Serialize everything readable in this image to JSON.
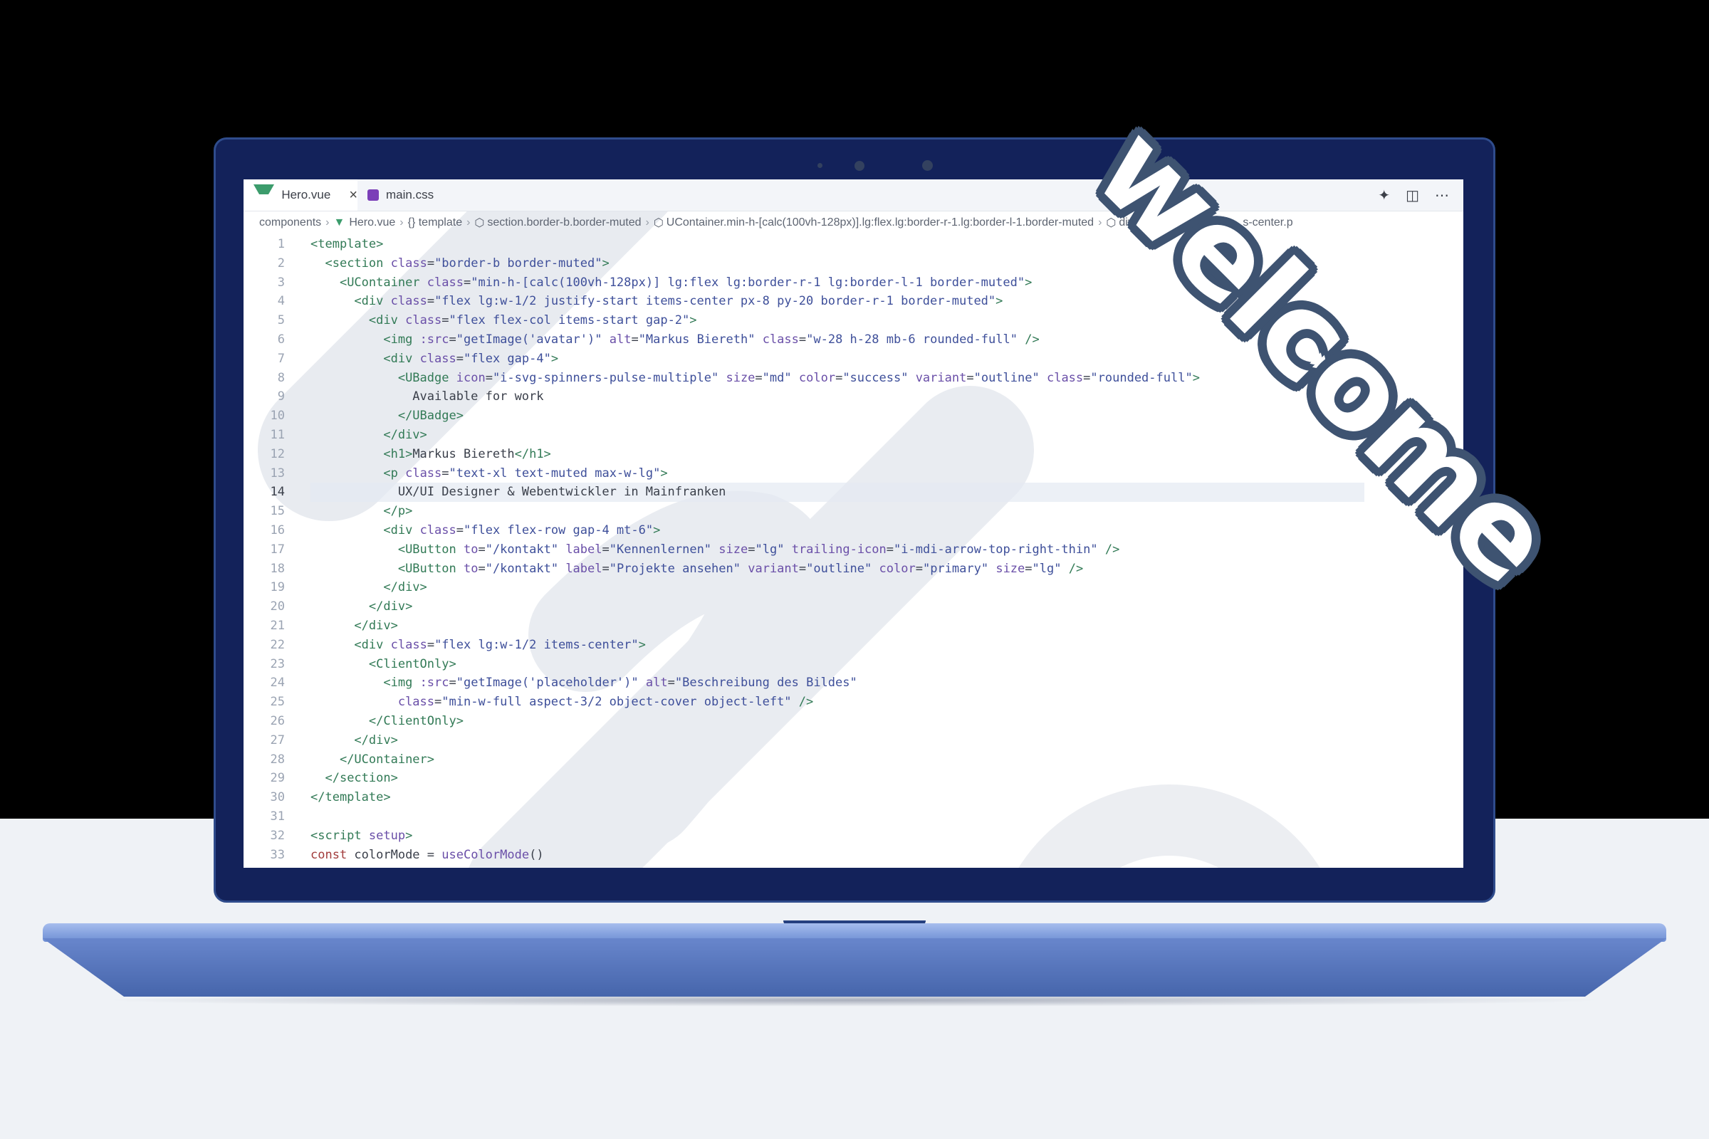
{
  "editor": {
    "tabs": [
      {
        "label": "Hero.vue",
        "icon": "vue-file-icon",
        "active": true
      },
      {
        "label": "main.css",
        "icon": "css-file-icon",
        "active": false
      }
    ],
    "toolbar_icons": [
      "sparkle-icon",
      "split-editor-icon",
      "more-icon"
    ],
    "breadcrumbs": [
      "components",
      "Hero.vue",
      "{} template",
      "section.border-b.border-muted",
      "UContainer.min-h-[calc(100vh-128px)].lg:flex.lg:border-r-1.lg:border-l-1.border-muted",
      "div.flex.lg:w...",
      "s-center.p"
    ],
    "current_line": 14,
    "lines": [
      {
        "n": "1",
        "tokens": [
          [
            "t",
            "<template>"
          ]
        ]
      },
      {
        "n": "2",
        "tokens": [
          [
            "p",
            "  "
          ],
          [
            "t",
            "<section"
          ],
          [
            "p",
            " "
          ],
          [
            "a",
            "class"
          ],
          [
            "p",
            "="
          ],
          [
            "s",
            "\"border-b border-muted\""
          ],
          [
            "t",
            ">"
          ]
        ]
      },
      {
        "n": "3",
        "tokens": [
          [
            "p",
            "    "
          ],
          [
            "t",
            "<UContainer"
          ],
          [
            "p",
            " "
          ],
          [
            "a",
            "class"
          ],
          [
            "p",
            "="
          ],
          [
            "s",
            "\"min-h-[calc(100vh-128px)] lg:flex lg:border-r-1 lg:border-l-1 border-muted\""
          ],
          [
            "t",
            ">"
          ]
        ]
      },
      {
        "n": "4",
        "tokens": [
          [
            "p",
            "      "
          ],
          [
            "t",
            "<div"
          ],
          [
            "p",
            " "
          ],
          [
            "a",
            "class"
          ],
          [
            "p",
            "="
          ],
          [
            "s",
            "\"flex lg:w-1/2 justify-start items-center px-8 py-20 border-r-1 border-muted\""
          ],
          [
            "t",
            ">"
          ]
        ]
      },
      {
        "n": "5",
        "tokens": [
          [
            "p",
            "        "
          ],
          [
            "t",
            "<div"
          ],
          [
            "p",
            " "
          ],
          [
            "a",
            "class"
          ],
          [
            "p",
            "="
          ],
          [
            "s",
            "\"flex flex-col items-start gap-2\""
          ],
          [
            "t",
            ">"
          ]
        ]
      },
      {
        "n": "6",
        "tokens": [
          [
            "p",
            "          "
          ],
          [
            "t",
            "<img"
          ],
          [
            "p",
            " "
          ],
          [
            "a",
            ":src"
          ],
          [
            "p",
            "="
          ],
          [
            "s",
            "\"getImage('avatar')\""
          ],
          [
            "p",
            " "
          ],
          [
            "a",
            "alt"
          ],
          [
            "p",
            "="
          ],
          [
            "s",
            "\"Markus Biereth\""
          ],
          [
            "p",
            " "
          ],
          [
            "a",
            "class"
          ],
          [
            "p",
            "="
          ],
          [
            "s",
            "\"w-28 h-28 mb-6 rounded-full\""
          ],
          [
            "p",
            " "
          ],
          [
            "t",
            "/>"
          ]
        ]
      },
      {
        "n": "7",
        "tokens": [
          [
            "p",
            "          "
          ],
          [
            "t",
            "<div"
          ],
          [
            "p",
            " "
          ],
          [
            "a",
            "class"
          ],
          [
            "p",
            "="
          ],
          [
            "s",
            "\"flex gap-4\""
          ],
          [
            "t",
            ">"
          ]
        ]
      },
      {
        "n": "8",
        "tokens": [
          [
            "p",
            "            "
          ],
          [
            "t",
            "<UBadge"
          ],
          [
            "p",
            " "
          ],
          [
            "a",
            "icon"
          ],
          [
            "p",
            "="
          ],
          [
            "s",
            "\"i-svg-spinners-pulse-multiple\""
          ],
          [
            "p",
            " "
          ],
          [
            "a",
            "size"
          ],
          [
            "p",
            "="
          ],
          [
            "s",
            "\"md\""
          ],
          [
            "p",
            " "
          ],
          [
            "a",
            "color"
          ],
          [
            "p",
            "="
          ],
          [
            "s",
            "\"success\""
          ],
          [
            "p",
            " "
          ],
          [
            "a",
            "variant"
          ],
          [
            "p",
            "="
          ],
          [
            "s",
            "\"outline\""
          ],
          [
            "p",
            " "
          ],
          [
            "a",
            "class"
          ],
          [
            "p",
            "="
          ],
          [
            "s",
            "\"rounded-full\""
          ],
          [
            "t",
            ">"
          ]
        ]
      },
      {
        "n": "9",
        "tokens": [
          [
            "p",
            "              Available for work"
          ]
        ]
      },
      {
        "n": "10",
        "tokens": [
          [
            "p",
            "            "
          ],
          [
            "t",
            "</UBadge>"
          ]
        ]
      },
      {
        "n": "11",
        "tokens": [
          [
            "p",
            "          "
          ],
          [
            "t",
            "</div>"
          ]
        ]
      },
      {
        "n": "12",
        "tokens": [
          [
            "p",
            "          "
          ],
          [
            "t",
            "<h1>"
          ],
          [
            "p",
            "Markus Biereth"
          ],
          [
            "t",
            "</h1>"
          ]
        ]
      },
      {
        "n": "13",
        "tokens": [
          [
            "p",
            "          "
          ],
          [
            "t",
            "<p"
          ],
          [
            "p",
            " "
          ],
          [
            "a",
            "class"
          ],
          [
            "p",
            "="
          ],
          [
            "s",
            "\"text-xl text-muted max-w-lg\""
          ],
          [
            "t",
            ">"
          ]
        ]
      },
      {
        "n": "14",
        "tokens": [
          [
            "p",
            "            UX/UI Designer & Webentwickler in Mainfranken"
          ]
        ]
      },
      {
        "n": "15",
        "tokens": [
          [
            "p",
            "          "
          ],
          [
            "t",
            "</p>"
          ]
        ]
      },
      {
        "n": "16",
        "tokens": [
          [
            "p",
            "          "
          ],
          [
            "t",
            "<div"
          ],
          [
            "p",
            " "
          ],
          [
            "a",
            "class"
          ],
          [
            "p",
            "="
          ],
          [
            "s",
            "\"flex flex-row gap-4 mt-6\""
          ],
          [
            "t",
            ">"
          ]
        ]
      },
      {
        "n": "17",
        "tokens": [
          [
            "p",
            "            "
          ],
          [
            "t",
            "<UButton"
          ],
          [
            "p",
            " "
          ],
          [
            "a",
            "to"
          ],
          [
            "p",
            "="
          ],
          [
            "s",
            "\"/kontakt\""
          ],
          [
            "p",
            " "
          ],
          [
            "a",
            "label"
          ],
          [
            "p",
            "="
          ],
          [
            "s",
            "\"Kennenlernen\""
          ],
          [
            "p",
            " "
          ],
          [
            "a",
            "size"
          ],
          [
            "p",
            "="
          ],
          [
            "s",
            "\"lg\""
          ],
          [
            "p",
            " "
          ],
          [
            "a",
            "trailing-icon"
          ],
          [
            "p",
            "="
          ],
          [
            "s",
            "\"i-mdi-arrow-top-right-thin\""
          ],
          [
            "p",
            " "
          ],
          [
            "t",
            "/>"
          ]
        ]
      },
      {
        "n": "18",
        "tokens": [
          [
            "p",
            "            "
          ],
          [
            "t",
            "<UButton"
          ],
          [
            "p",
            " "
          ],
          [
            "a",
            "to"
          ],
          [
            "p",
            "="
          ],
          [
            "s",
            "\"/kontakt\""
          ],
          [
            "p",
            " "
          ],
          [
            "a",
            "label"
          ],
          [
            "p",
            "="
          ],
          [
            "s",
            "\"Projekte ansehen\""
          ],
          [
            "p",
            " "
          ],
          [
            "a",
            "variant"
          ],
          [
            "p",
            "="
          ],
          [
            "s",
            "\"outline\""
          ],
          [
            "p",
            " "
          ],
          [
            "a",
            "color"
          ],
          [
            "p",
            "="
          ],
          [
            "s",
            "\"primary\""
          ],
          [
            "p",
            " "
          ],
          [
            "a",
            "size"
          ],
          [
            "p",
            "="
          ],
          [
            "s",
            "\"lg\""
          ],
          [
            "p",
            " "
          ],
          [
            "t",
            "/>"
          ]
        ]
      },
      {
        "n": "19",
        "tokens": [
          [
            "p",
            "          "
          ],
          [
            "t",
            "</div>"
          ]
        ]
      },
      {
        "n": "20",
        "tokens": [
          [
            "p",
            "        "
          ],
          [
            "t",
            "</div>"
          ]
        ]
      },
      {
        "n": "21",
        "tokens": [
          [
            "p",
            "      "
          ],
          [
            "t",
            "</div>"
          ]
        ]
      },
      {
        "n": "22",
        "tokens": [
          [
            "p",
            "      "
          ],
          [
            "t",
            "<div"
          ],
          [
            "p",
            " "
          ],
          [
            "a",
            "class"
          ],
          [
            "p",
            "="
          ],
          [
            "s",
            "\"flex lg:w-1/2 items-center\""
          ],
          [
            "t",
            ">"
          ]
        ]
      },
      {
        "n": "23",
        "tokens": [
          [
            "p",
            "        "
          ],
          [
            "t",
            "<ClientOnly>"
          ]
        ]
      },
      {
        "n": "24",
        "tokens": [
          [
            "p",
            "          "
          ],
          [
            "t",
            "<img"
          ],
          [
            "p",
            " "
          ],
          [
            "a",
            ":src"
          ],
          [
            "p",
            "="
          ],
          [
            "s",
            "\"getImage('placeholder')\""
          ],
          [
            "p",
            " "
          ],
          [
            "a",
            "alt"
          ],
          [
            "p",
            "="
          ],
          [
            "s",
            "\"Beschreibung des Bildes\""
          ]
        ]
      },
      {
        "n": "25",
        "tokens": [
          [
            "p",
            "            "
          ],
          [
            "a",
            "class"
          ],
          [
            "p",
            "="
          ],
          [
            "s",
            "\"min-w-full aspect-3/2 object-cover object-left\""
          ],
          [
            "p",
            " "
          ],
          [
            "t",
            "/>"
          ]
        ]
      },
      {
        "n": "26",
        "tokens": [
          [
            "p",
            "        "
          ],
          [
            "t",
            "</ClientOnly>"
          ]
        ]
      },
      {
        "n": "27",
        "tokens": [
          [
            "p",
            "      "
          ],
          [
            "t",
            "</div>"
          ]
        ]
      },
      {
        "n": "28",
        "tokens": [
          [
            "p",
            "    "
          ],
          [
            "t",
            "</UContainer>"
          ]
        ]
      },
      {
        "n": "29",
        "tokens": [
          [
            "p",
            "  "
          ],
          [
            "t",
            "</section>"
          ]
        ]
      },
      {
        "n": "30",
        "tokens": [
          [
            "t",
            "</template>"
          ]
        ]
      },
      {
        "n": "31",
        "tokens": []
      },
      {
        "n": "32",
        "tokens": [
          [
            "t",
            "<script"
          ],
          [
            "p",
            " "
          ],
          [
            "a",
            "setup"
          ],
          [
            "t",
            ">"
          ]
        ]
      },
      {
        "n": "33",
        "tokens": [
          [
            "k",
            "const"
          ],
          [
            "p",
            " colorMode = "
          ],
          [
            "f",
            "useColorMode"
          ],
          [
            "p",
            "()"
          ]
        ]
      }
    ]
  },
  "sticker": {
    "text": "welcome",
    "fill": "#ffffff",
    "outline": "#3e5371"
  },
  "colors": {
    "laptop_bezel": "#13225a",
    "laptop_base": "#5f7fc6",
    "floor": "#eff2f6",
    "backdrop": "#000000"
  }
}
